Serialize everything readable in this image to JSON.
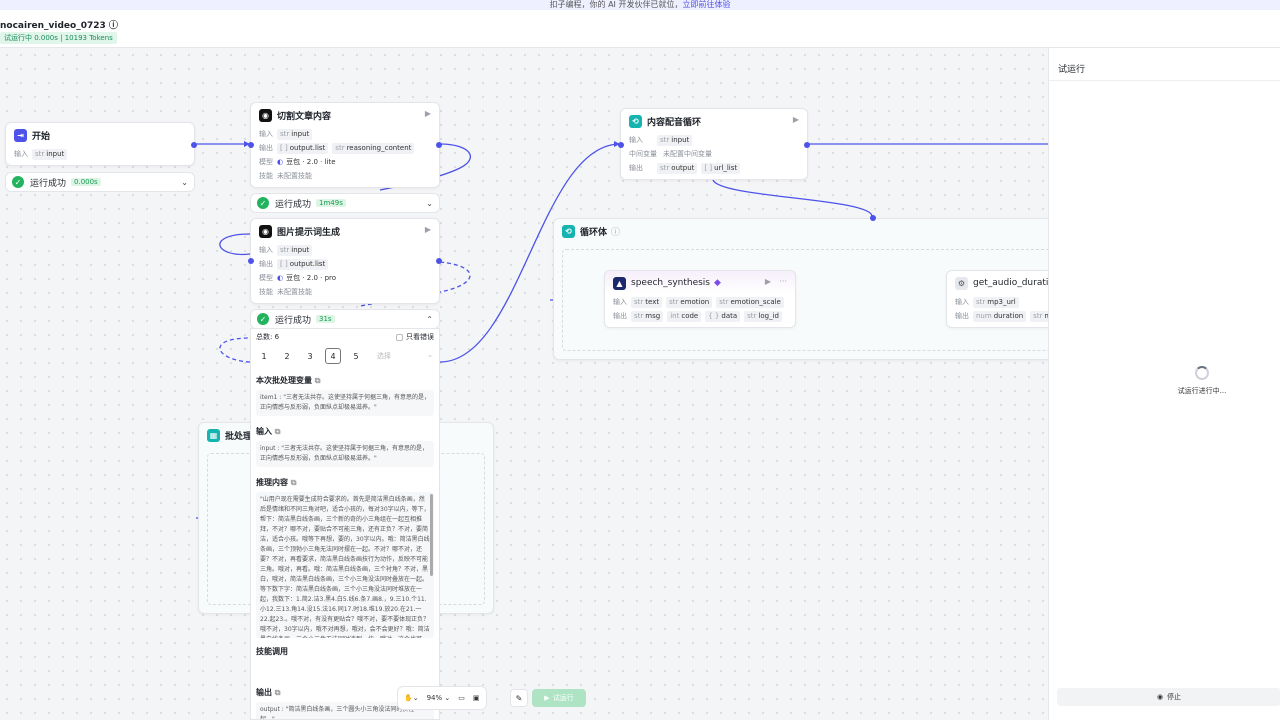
{
  "banner": {
    "text": "扣子编程，你的 AI 开发伙伴已就位，",
    "link": "立即前往体验"
  },
  "workflow": {
    "title": "nocairen_video_0723",
    "status": "试运行中 0.000s | 10193 Tokens"
  },
  "colors": {
    "accent": "#4d53e8",
    "success": "#22b35e",
    "loop": "#16b4b0"
  },
  "nodes": {
    "start": {
      "title": "开始",
      "input_label": "输入",
      "input": "input",
      "run_status": "运行成功",
      "run_time": "0.000s"
    },
    "split": {
      "title": "切割文章内容",
      "input_label": "输入",
      "input": "input",
      "output_label": "输出",
      "outputs": [
        "output.list",
        "reasoning_content"
      ],
      "model_label": "模型",
      "model": "豆包 · 2.0 · lite",
      "skill_label": "技能",
      "skill": "未配置技能",
      "run_status": "运行成功",
      "run_time": "1m49s"
    },
    "img_prompt": {
      "title": "图片提示词生成",
      "input_label": "输入",
      "input": "input",
      "output_label": "输出",
      "output": "output.list",
      "model_label": "模型",
      "model": "豆包 · 2.0 · pro",
      "skill_label": "技能",
      "skill": "未配置技能",
      "run_status": "运行成功",
      "run_time": "31s"
    },
    "content_loop": {
      "title": "内容配音循环",
      "input_label": "输入",
      "input": "input",
      "mid_label": "中间变量",
      "mid": "未配置中间变量",
      "output_label": "输出",
      "outputs": [
        "output",
        "url_list"
      ]
    },
    "loop_body": {
      "title": "循环体"
    },
    "speech": {
      "title": "speech_synthesis",
      "input_label": "输入",
      "inputs": [
        "text",
        "emotion",
        "emotion_scale"
      ],
      "output_label": "输出",
      "outputs": [
        "msg",
        "code",
        "data",
        "log_id"
      ]
    },
    "audio": {
      "title": "get_audio_duration",
      "input_label": "输入",
      "input": "mp3_url",
      "output_label": "输出",
      "outputs": [
        "duration",
        "message"
      ]
    },
    "batch": {
      "title": "批处理"
    }
  },
  "batch_panel": {
    "total": "总数: 6",
    "only_errors": "只看错误",
    "pages": [
      "1",
      "2",
      "3",
      "4",
      "5"
    ],
    "select_placeholder": "选择",
    "batch_var_title": "本次批处理变量",
    "batch_var_text": "item1 : \"三者无法共存。这使坚持属于何据三角，有意思的是，正向情感与反形弱，负面纵点却极易滋养。\"",
    "input_title": "输入",
    "input_text": "input : \"三者无法共存。这使坚持属于何据三角，有意思的是，正向情感与反形弱，负面纵点却极易滋养。\"",
    "reasoning_title": "推理内容",
    "reasoning_text": "\"山用户现在需要生成符合要求的。首先是简洁黑白线条画，然后是情绪和不同三角对吧，适合小孩的，每对30字以内，等下，帮下：简洁黑白线条画，三个新的奇的小三角组在一起互相推拜，不对？哪不对，要贴合不可能三角，还有正负？不对，要简洁，适合小孩。哦等下再想，要的，30字以内。哦：简洁黑白线条画，三个顶勃小三角无法同时摆在一起。不对？哪不对，还要？不对，再看要求，简洁黑白线条画技行为动作，反映不可能三角。哦对，再看。哦：简洁黑白线条画，三个衬角？不对，黑白，哦对，简洁黑白线条画，三个小三角没法同时叠放在一起。等下数下字：简洁黑白线条画，三个小三角没法同时堆放在一起，我数下：1.简2.洁3.黑4.白5.线6.条7.画8.，9.三10.个11.小12.三13.角14.没15.法16.同17.时18.堆19.放20.在21.一22.起23.。哦不对，有没有更贴合？哦不对，要不要体现正负？哦不对，30字以内，哦不对再想，哦对，会不会更好？哦：简洁黑白线条画，三个小三角无法同时凑到一块。哦对，这个也可以？不对，等下，需贴贴阶不不冲三角，还有正向情绪和负面情绪…\"",
    "skill_title": "技能调用",
    "output_title": "输出",
    "output_text": "output : \"简洁黑白线条画，三个圆头小三角没法同时挤在一起。\""
  },
  "right_panel": {
    "title": "试运行",
    "running": "试运行进行中...",
    "stop": "停止"
  },
  "toolbar": {
    "zoom": "94%",
    "run": "试运行"
  }
}
